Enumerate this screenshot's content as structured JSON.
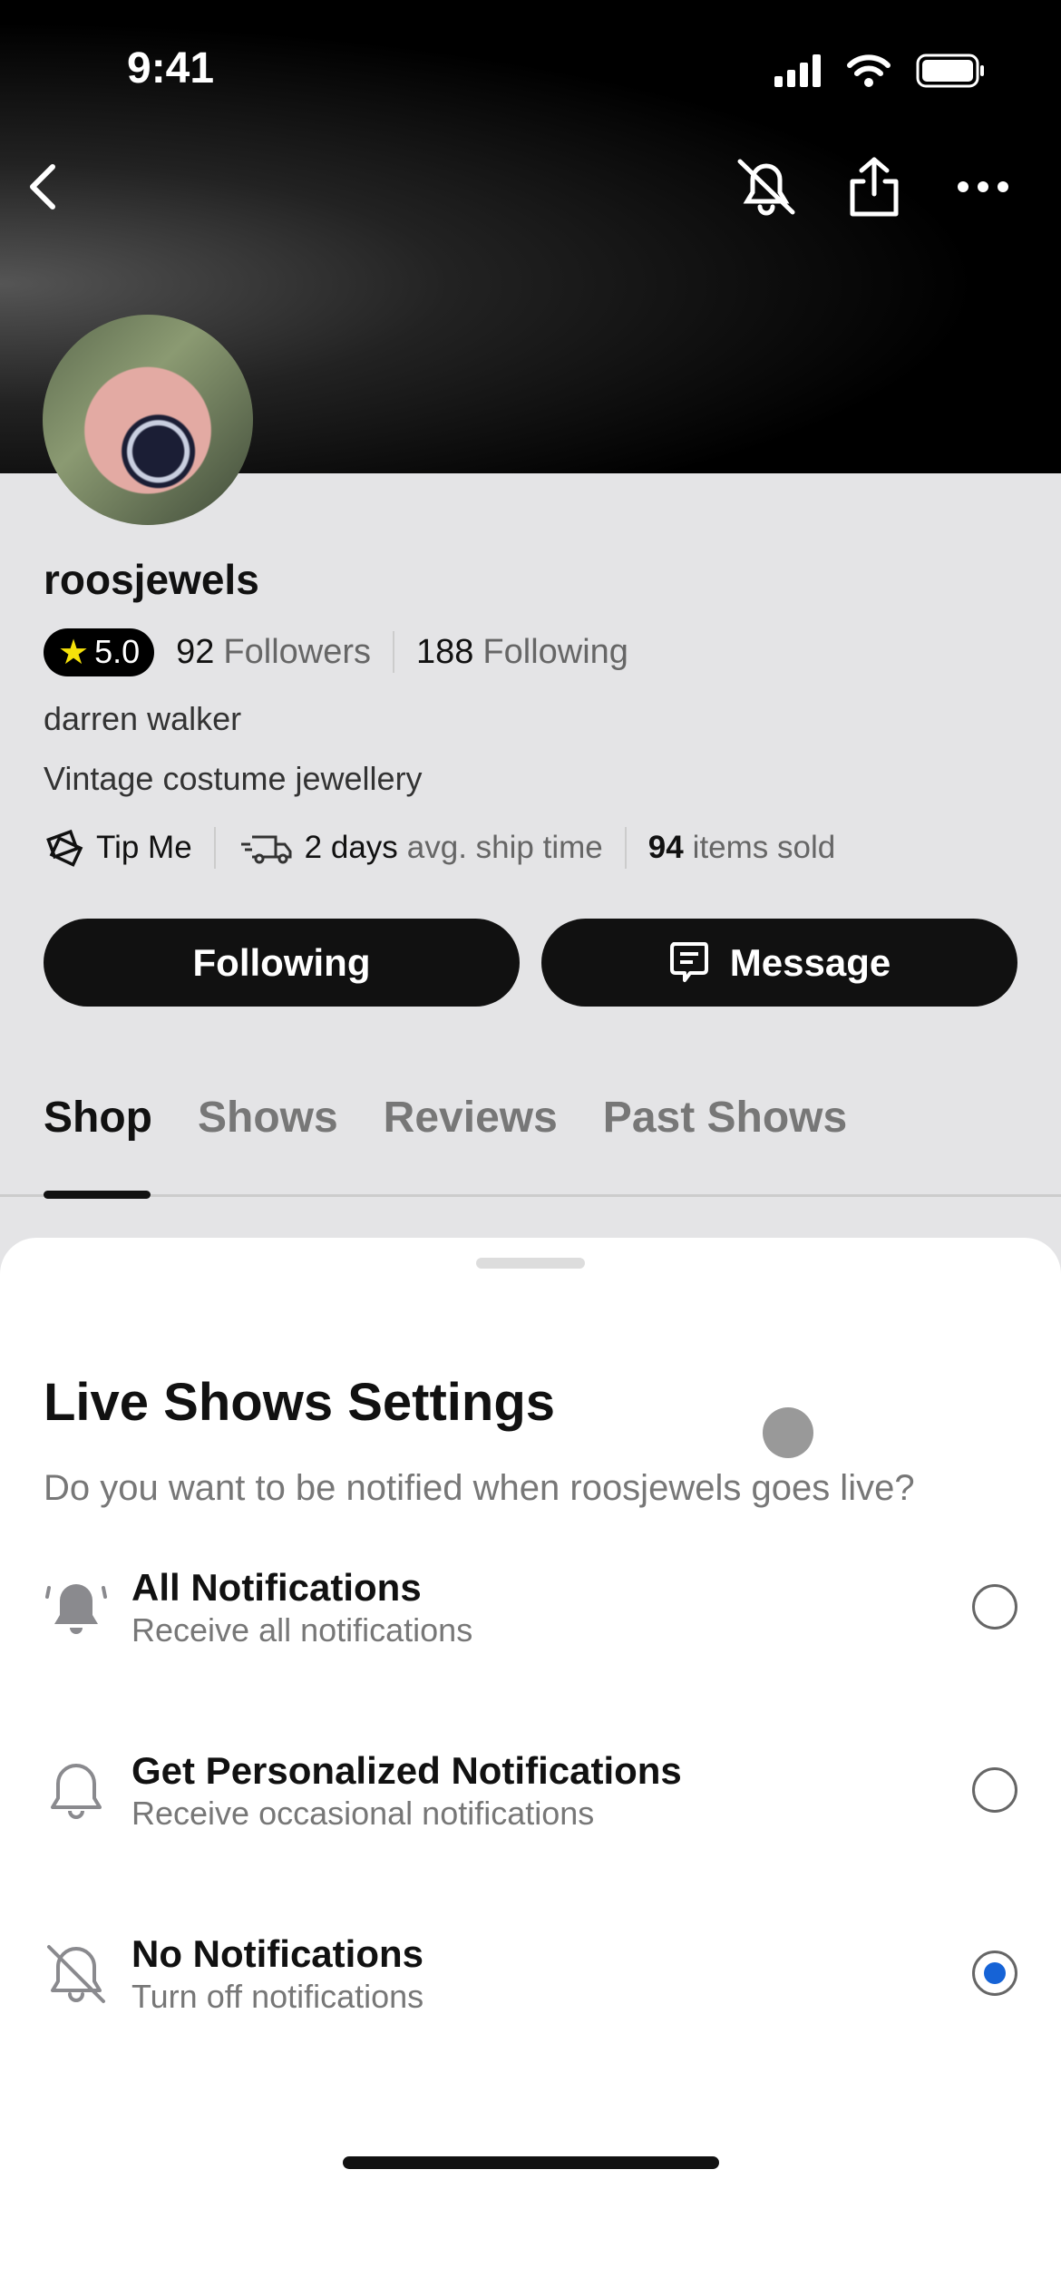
{
  "status_bar": {
    "time": "9:41"
  },
  "profile": {
    "username": "roosjewels",
    "rating": "5.0",
    "followers_count": "92",
    "followers_label": "Followers",
    "following_count": "188",
    "following_label": "Following",
    "name": "darren walker",
    "bio": "Vintage costume jewellery",
    "tip_label": "Tip Me",
    "ship_days": "2 days",
    "ship_label": "avg. ship time",
    "sold_count": "94",
    "sold_label": "items sold",
    "following_button": "Following",
    "message_button": "Message"
  },
  "tabs": [
    {
      "label": "Shop",
      "active": true
    },
    {
      "label": "Shows"
    },
    {
      "label": "Reviews"
    },
    {
      "label": "Past Shows"
    }
  ],
  "sheet": {
    "title": "Live Shows Settings",
    "subtitle": "Do you want to be notified when roosjewels goes live?",
    "options": [
      {
        "title": "All Notifications",
        "subtitle": "Receive all notifications",
        "icon": "bell-ringing-filled-icon",
        "selected": false
      },
      {
        "title": "Get Personalized Notifications",
        "subtitle": "Receive occasional notifications",
        "icon": "bell-outline-icon",
        "selected": false
      },
      {
        "title": "No Notifications",
        "subtitle": "Turn off notifications",
        "icon": "bell-off-icon",
        "selected": true
      }
    ]
  },
  "colors": {
    "accent": "#1663d6",
    "button": "#111111"
  }
}
